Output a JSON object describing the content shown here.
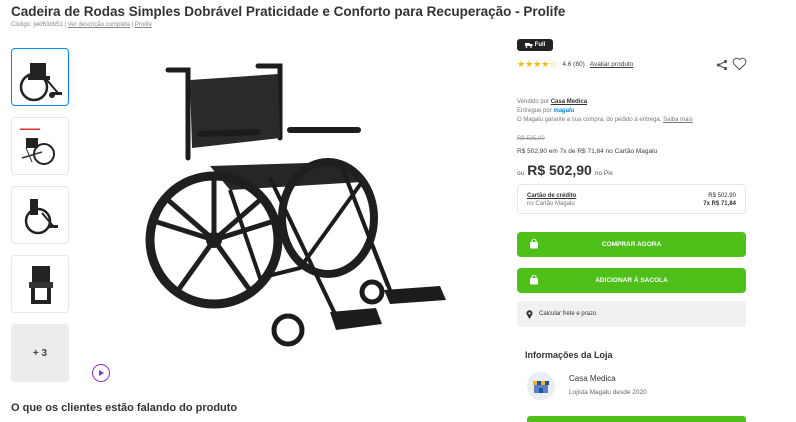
{
  "product": {
    "title": "Cadeira de Rodas Simples Dobrável Praticidade e Conforto para Recuperação - Prolife",
    "code": "Código: jekf63db51",
    "separator1": " | ",
    "description_link": "Ver descrição completa",
    "separator2": " | ",
    "brand_link": "Prolife"
  },
  "gallery": {
    "more_label": "+ 3"
  },
  "badge": {
    "label": "Full"
  },
  "rating": {
    "value": "4.6 (80)",
    "review_link": "Avaliar produto",
    "stars_count": 4.6
  },
  "seller": {
    "sold_by_prefix": "Vendido por ",
    "sold_by_name": "Casa Medica",
    "delivered_by_prefix": "Entregue por ",
    "delivered_by_name": "magalu",
    "guarantee": "O Magalu garante a sua compra, do pedido à entrega. ",
    "guarantee_link": "Saiba mais"
  },
  "pricing": {
    "old_price": "R$ 535,00",
    "installments": "R$ 502,90 em 7x de R$ 71,84 no Cartão Magalu",
    "price_prefix": "ou",
    "price": "R$ 502,90",
    "price_suffix": "no Pix",
    "card_title": "Cartão de crédito",
    "card_sub": "no Cartão Magalu",
    "card_total": "R$ 502,90",
    "card_install": "7x R$ 71,84"
  },
  "actions": {
    "buy_now": "COMPRAR AGORA",
    "add_to_bag": "ADICIONAR À SACOLA",
    "freight": "Calcular frete e prazo"
  },
  "store": {
    "heading": "Informações da Loja",
    "name": "Casa Medica",
    "since": "Lojista Magalu desde 2020"
  },
  "reviews": {
    "heading": "O que os clientes estão falando do produto"
  },
  "colors": {
    "accent_green": "#4fbf1a",
    "magalu_blue": "#0086ff",
    "star_yellow": "#f5b800",
    "video_purple": "#8b2fd9"
  }
}
